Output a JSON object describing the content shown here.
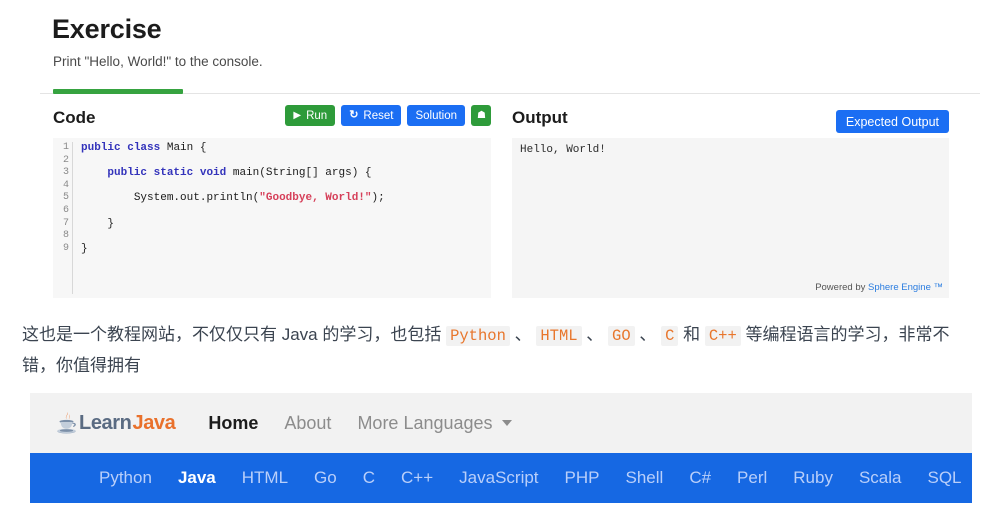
{
  "exercise": {
    "title": "Exercise",
    "description": "Print \"Hello, World!\" to the console."
  },
  "code_panel": {
    "title": "Code",
    "buttons": {
      "run": "Run",
      "reset": "Reset",
      "solution": "Solution",
      "expand_icon": "chevron-double-down"
    },
    "line_numbers": [
      "1",
      "2",
      "3",
      "4",
      "5",
      "6",
      "7",
      "8",
      "9"
    ],
    "code_lines": [
      "public class Main {",
      "",
      "    public static void main(String[] args) {",
      "",
      "        System.out.println(\"Goodbye, World!\");",
      "",
      "    }",
      "",
      "}"
    ]
  },
  "output_panel": {
    "title": "Output",
    "expected_button": "Expected Output",
    "output_text": "Hello, World!",
    "powered_prefix": "Powered by ",
    "powered_brand": "Sphere Engine ™"
  },
  "paragraph": {
    "seg1": "这也是一个教程网站，不仅仅只有 Java 的学习，也包括 ",
    "code1": "Python",
    "sep1": " 、 ",
    "code2": "HTML",
    "sep2": " 、 ",
    "code3": "GO",
    "sep3": " 、 ",
    "code4": "C",
    "sep4": " 和 ",
    "code5": "C++",
    "seg2": " 等编程语言的学习，非常不错，你值得拥有"
  },
  "nav": {
    "logo_learn": "Learn",
    "logo_java": "Java",
    "links": [
      {
        "label": "Home",
        "active": true
      },
      {
        "label": "About",
        "active": false
      },
      {
        "label": "More Languages",
        "active": false,
        "has_caret": true
      }
    ],
    "languages": [
      {
        "label": "Python",
        "active": false
      },
      {
        "label": "Java",
        "active": true
      },
      {
        "label": "HTML",
        "active": false
      },
      {
        "label": "Go",
        "active": false
      },
      {
        "label": "C",
        "active": false
      },
      {
        "label": "C++",
        "active": false
      },
      {
        "label": "JavaScript",
        "active": false
      },
      {
        "label": "PHP",
        "active": false
      },
      {
        "label": "Shell",
        "active": false
      },
      {
        "label": "C#",
        "active": false
      },
      {
        "label": "Perl",
        "active": false
      },
      {
        "label": "Ruby",
        "active": false
      },
      {
        "label": "Scala",
        "active": false
      },
      {
        "label": "SQL",
        "active": false
      }
    ]
  },
  "colors": {
    "accent_green": "#36a340",
    "accent_blue": "#1b6ef3",
    "nav_blue": "#1668e3",
    "code_orange": "#e8762c",
    "string_red": "#d6405a",
    "keyword_blue": "#3333bb"
  }
}
